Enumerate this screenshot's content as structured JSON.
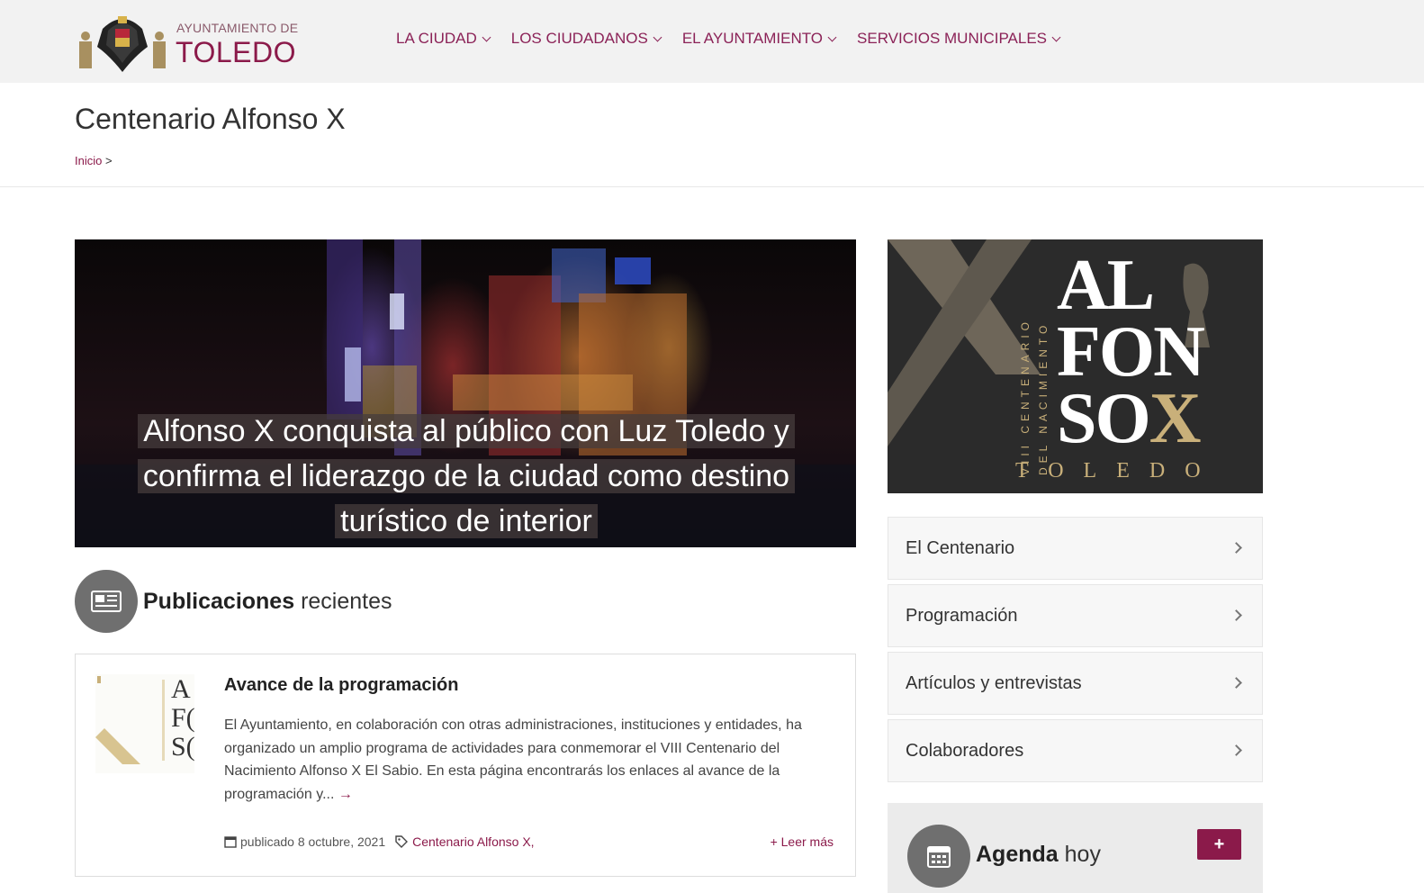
{
  "header": {
    "logo_small": "AYUNTAMIENTO DE",
    "logo_big": "TOLEDO",
    "nav": [
      {
        "label": "LA CIUDAD"
      },
      {
        "label": "LOS CIUDADANOS"
      },
      {
        "label": "EL AYUNTAMIENTO"
      },
      {
        "label": "SERVICIOS MUNICIPALES"
      }
    ]
  },
  "page": {
    "title": "Centenario Alfonso X",
    "breadcrumb_home": "Inicio",
    "breadcrumb_sep": ">"
  },
  "hero": {
    "caption_line1": "Alfonso X conquista al público con Luz Toledo y",
    "caption_line2": "confirma el liderazgo de la ciudad como destino",
    "caption_line3": "turístico de interior"
  },
  "publications": {
    "heading_bold": "Publicaciones",
    "heading_light": "recientes"
  },
  "post": {
    "title": "Avance de la programación",
    "excerpt": "El Ayuntamiento, en colaboración con otras administraciones, instituciones y entidades, ha organizado un amplio programa de actividades para conmemorar el VIII Centenario del Nacimiento Alfonso X El Sabio. En esta página encontrarás los enlaces al avance de la programación y...",
    "arrow": "→",
    "published": "publicado 8 octubre, 2021",
    "category": "Centenario Alfonso X,",
    "read_more": "+ Leer más",
    "thumb_letters": [
      "A",
      "F(",
      "S("
    ]
  },
  "banner": {
    "line1": "AL",
    "line2": "FON",
    "line3": "SO",
    "line3_x": "X",
    "vertical1": "VIII CENTENARIO",
    "vertical2": "DEL NACIMIENTO",
    "bottom": "TOLEDO"
  },
  "sidebar": {
    "items": [
      {
        "label": "El Centenario"
      },
      {
        "label": "Programación"
      },
      {
        "label": "Artículos y entrevistas"
      },
      {
        "label": "Colaboradores"
      }
    ]
  },
  "agenda": {
    "bold": "Agenda",
    "light": "hoy",
    "button": "+"
  },
  "colors": {
    "brand": "#8b1a4a",
    "icon_circle": "#6f6f6f",
    "banner_gold": "#c9b07a"
  }
}
